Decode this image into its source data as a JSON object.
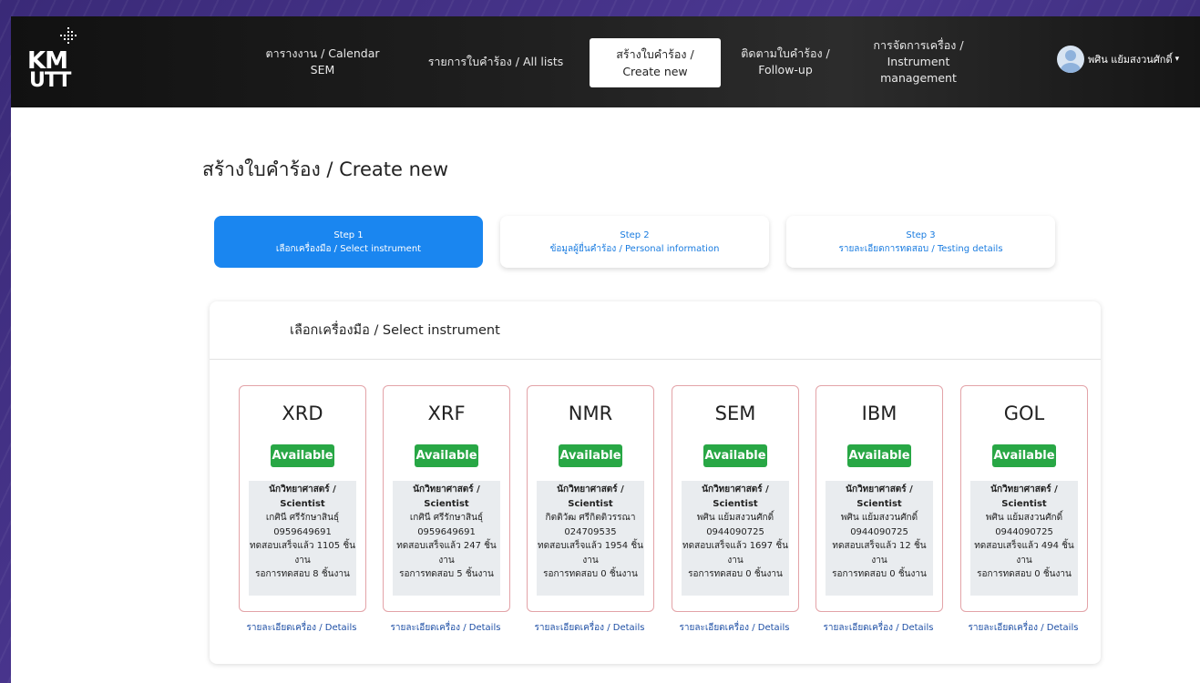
{
  "brand": {
    "logo_top": "KM",
    "logo_bottom": "UTT"
  },
  "nav": {
    "items": [
      {
        "label": "ตารางงาน / Calendar\nSEM"
      },
      {
        "label": "รายการใบคำร้อง / All lists"
      },
      {
        "label": "สร้างใบคำร้อง /\nCreate new",
        "active": true
      },
      {
        "label": "ติดตามใบคำร้อง /\nFollow-up"
      },
      {
        "label": "การจัดการเครื่อง /\nInstrument\nmanagement"
      }
    ],
    "user_name": "พศิน แย้มสงวนศักดิ์"
  },
  "page_title": "สร้างใบคำร้อง / Create new",
  "steps": [
    {
      "label": "Step 1",
      "sub": "เลือกเครื่องมือ / Select instrument",
      "active": true
    },
    {
      "label": "Step 2",
      "sub": "ข้อมูลผู้ยื่นคำร้อง / Personal information",
      "active": false
    },
    {
      "label": "Step 3",
      "sub": "รายละเอียดการทดสอบ / Testing details",
      "active": false
    }
  ],
  "section_title": "เลือกเครื่องมือ / Select instrument",
  "status_color": "#28a745",
  "accent_color": "#1a86f0",
  "instruments": [
    {
      "name": "XRD",
      "status": "Available",
      "role": "นักวิทยาศาสตร์ /",
      "role2": "Scientist",
      "scientist": "เกศินี ศรีรักษาสินธุ์",
      "phone": "0959649691",
      "tested": "ทดสอบเสร็จแล้ว 1105 ชิ้น",
      "tested2": "งาน",
      "waiting": "รอการทดสอบ 8 ชิ้นงาน",
      "details": "รายละเอียดเครื่อง / Details"
    },
    {
      "name": "XRF",
      "status": "Available",
      "role": "นักวิทยาศาสตร์ /",
      "role2": "Scientist",
      "scientist": "เกศินี ศรีรักษาสินธุ์",
      "phone": "0959649691",
      "tested": "ทดสอบเสร็จแล้ว 247 ชิ้น",
      "tested2": "งาน",
      "waiting": "รอการทดสอบ 5 ชิ้นงาน",
      "details": "รายละเอียดเครื่อง / Details"
    },
    {
      "name": "NMR",
      "status": "Available",
      "role": "นักวิทยาศาสตร์ /",
      "role2": "Scientist",
      "scientist": "กิตติวัฒ ศรีกิตติวรรณา",
      "phone": "024709535",
      "tested": "ทดสอบเสร็จแล้ว 1954 ชิ้น",
      "tested2": "งาน",
      "waiting": "รอการทดสอบ 0 ชิ้นงาน",
      "details": "รายละเอียดเครื่อง / Details"
    },
    {
      "name": "SEM",
      "status": "Available",
      "role": "นักวิทยาศาสตร์ /",
      "role2": "Scientist",
      "scientist": "พศิน แย้มสงวนศักดิ์",
      "phone": "0944090725",
      "tested": "ทดสอบเสร็จแล้ว 1697 ชิ้น",
      "tested2": "งาน",
      "waiting": "รอการทดสอบ 0 ชิ้นงาน",
      "details": "รายละเอียดเครื่อง / Details"
    },
    {
      "name": "IBM",
      "status": "Available",
      "role": "นักวิทยาศาสตร์ /",
      "role2": "Scientist",
      "scientist": "พศิน แย้มสงวนศักดิ์",
      "phone": "0944090725",
      "tested": "ทดสอบเสร็จแล้ว 12 ชิ้น",
      "tested2": "งาน",
      "waiting": "รอการทดสอบ 0 ชิ้นงาน",
      "details": "รายละเอียดเครื่อง / Details"
    },
    {
      "name": "GOL",
      "status": "Available",
      "role": "นักวิทยาศาสตร์ /",
      "role2": "Scientist",
      "scientist": "พศิน แย้มสงวนศักดิ์",
      "phone": "0944090725",
      "tested": "ทดสอบเสร็จแล้ว 494 ชิ้น",
      "tested2": "งาน",
      "waiting": "รอการทดสอบ 0 ชิ้นงาน",
      "details": "รายละเอียดเครื่อง / Details"
    }
  ]
}
